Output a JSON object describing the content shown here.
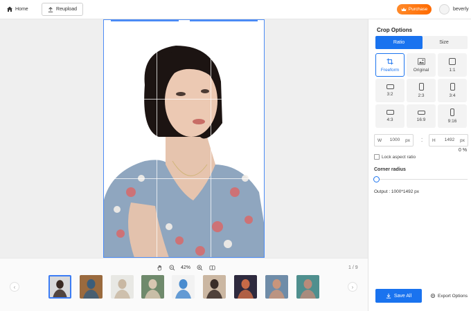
{
  "header": {
    "home_label": "Home",
    "reupload_label": "Reupload",
    "purchase_label": "Purchase",
    "username": "beverly"
  },
  "toolbar": {
    "zoom_value": "42%",
    "page_counter": "1 / 9"
  },
  "thumbnails": [
    {
      "name": "woman-portrait",
      "active": true,
      "bg": "#d9d9d9",
      "fg": "#3a2a22"
    },
    {
      "name": "bookshelf",
      "active": false,
      "bg": "#9a6a3e",
      "fg": "#3b5d7a"
    },
    {
      "name": "woman-with-phone",
      "active": false,
      "bg": "#e8e8e4",
      "fg": "#c9b8a3"
    },
    {
      "name": "woman-green-top",
      "active": false,
      "bg": "#6f8a6c",
      "fg": "#d8c7b2"
    },
    {
      "name": "woman-blue-shirt",
      "active": false,
      "bg": "#f2f2f2",
      "fg": "#4a8ccf"
    },
    {
      "name": "woman-room",
      "active": false,
      "bg": "#cbb7a2",
      "fg": "#3a2d28"
    },
    {
      "name": "woman-dark-room",
      "active": false,
      "bg": "#2e2a3e",
      "fg": "#c76a47"
    },
    {
      "name": "woman-floral",
      "active": false,
      "bg": "#6f8ca8",
      "fg": "#c9957b"
    },
    {
      "name": "woman-teal",
      "active": false,
      "bg": "#4f8f8e",
      "fg": "#b98b7a"
    }
  ],
  "panel": {
    "title": "Crop Options",
    "tabs": [
      {
        "label": "Ratio",
        "active": true
      },
      {
        "label": "Size",
        "active": false
      }
    ],
    "ratios": [
      {
        "label": "Freeform",
        "icon": "crop-icon",
        "active": true
      },
      {
        "label": "Original",
        "icon": "image-icon",
        "active": false
      },
      {
        "label": "1:1",
        "icon": "square-ratio-icon",
        "active": false
      },
      {
        "label": "3:2",
        "icon": "landscape-ratio-icon",
        "active": false
      },
      {
        "label": "2:3",
        "icon": "portrait-ratio-icon",
        "active": false
      },
      {
        "label": "3:4",
        "icon": "portrait-ratio-icon",
        "active": false
      },
      {
        "label": "4:3",
        "icon": "landscape-ratio-icon",
        "active": false
      },
      {
        "label": "16:9",
        "icon": "wide-ratio-icon",
        "active": false
      },
      {
        "label": "9:16",
        "icon": "tall-ratio-icon",
        "active": false
      }
    ],
    "width_label": "W",
    "width_value": "1000",
    "height_label": "H",
    "height_value": "1492",
    "unit": "px",
    "lock_label": "Lock aspect ratio",
    "corner_radius_label": "Corner radius",
    "corner_radius_value": "0 %",
    "output_text": "Output :  1000*1492 px",
    "save_all_label": "Save All",
    "export_label": "Export Options"
  },
  "colors": {
    "accent": "#1a73ef",
    "purchase": "#ff7a17"
  }
}
